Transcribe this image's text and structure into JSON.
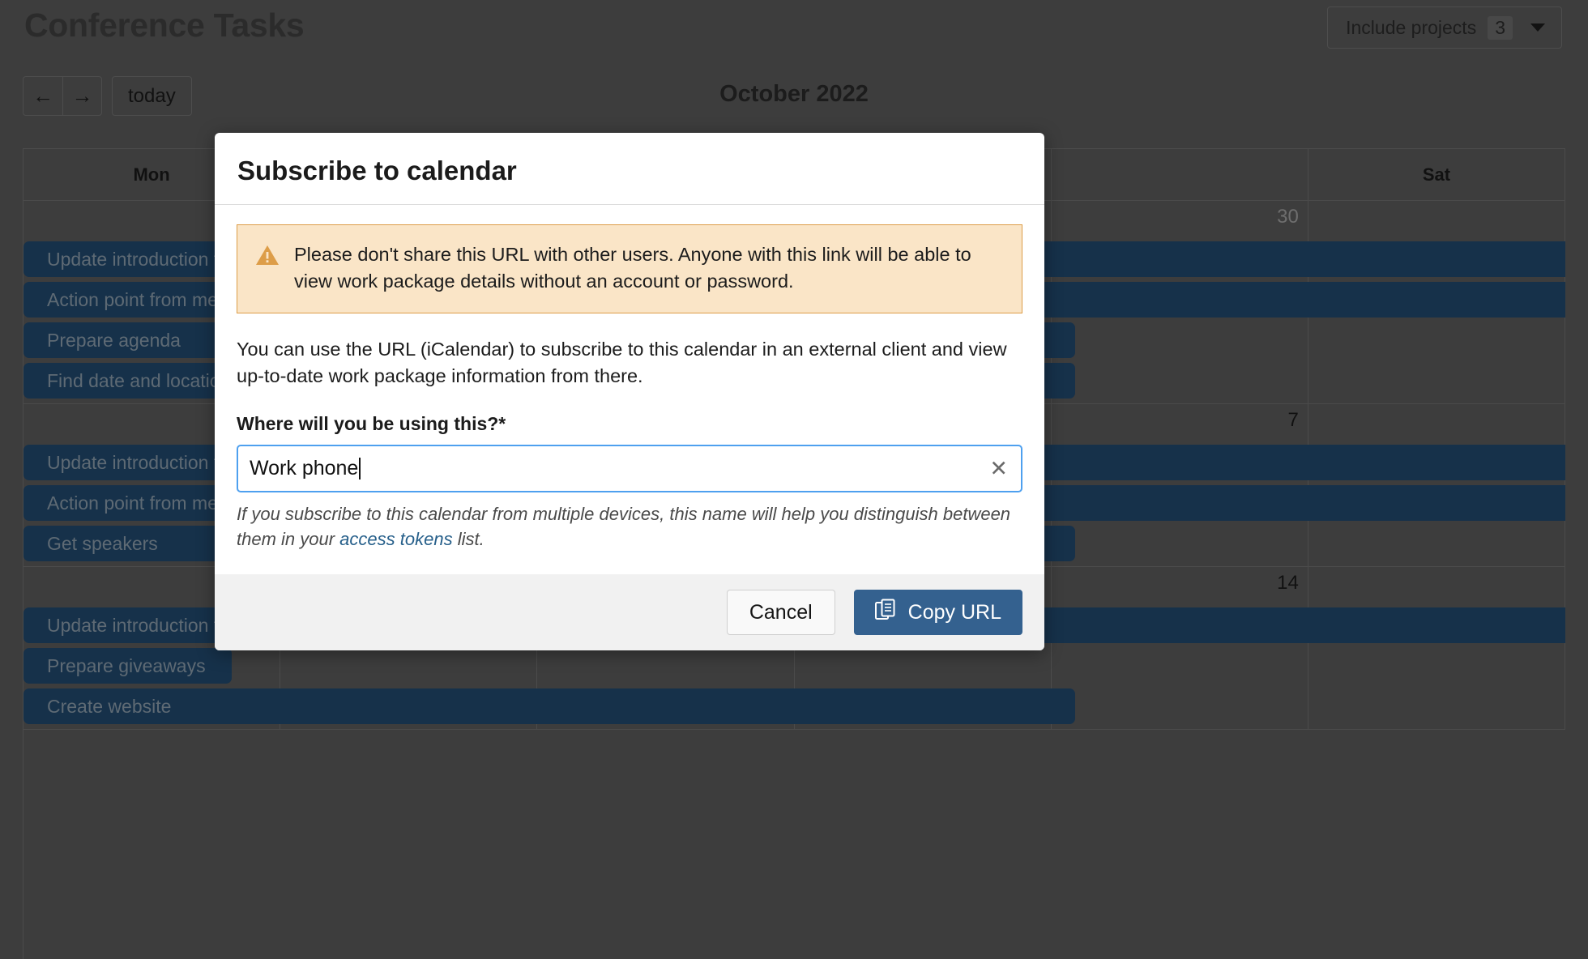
{
  "app": {
    "page_title": "Conference Tasks",
    "include_projects": {
      "label": "Include projects",
      "count": "3",
      "caret_icon": "chevron-down-icon"
    },
    "toolbar": {
      "prev_label": "←",
      "next_label": "→",
      "today_label": "today"
    },
    "calendar": {
      "month_title": "October 2022",
      "day_headers": [
        "Mon",
        "",
        "",
        "",
        "",
        "Sat"
      ],
      "weeks": [
        {
          "daynums": [
            "",
            "",
            "",
            "",
            "30",
            ""
          ],
          "events": [
            {
              "title": "Update introduction text",
              "span": "full"
            },
            {
              "title": "Action point from meeting",
              "span": "full"
            },
            {
              "title": "Prepare agenda",
              "span": "wide"
            },
            {
              "title": "Find date and location",
              "span": "wide"
            }
          ]
        },
        {
          "daynums": [
            "",
            "",
            "",
            "",
            "7",
            ""
          ],
          "events": [
            {
              "title": "Update introduction text",
              "span": "full"
            },
            {
              "title": "Action point from meeting",
              "span": "full"
            },
            {
              "title": "Get speakers",
              "span": "wide"
            }
          ]
        },
        {
          "daynums": [
            "",
            "",
            "",
            "",
            "14",
            ""
          ],
          "events": [
            {
              "title": "Update introduction text",
              "span": "full"
            },
            {
              "title": "Prepare giveaways",
              "span": "narrow"
            },
            {
              "title": "Create website",
              "span": "wide"
            }
          ]
        }
      ]
    }
  },
  "modal": {
    "title": "Subscribe to calendar",
    "warning": {
      "icon": "warning-triangle-icon",
      "text": "Please don't share this URL with other users. Anyone with this link will be able to view work package details without an account or password."
    },
    "body_text": "You can use the URL (iCalendar) to subscribe to this calendar in an external client and view up-to-date work package information from there.",
    "field": {
      "label": "Where will you be using this?*",
      "value": "Work phone",
      "placeholder": "",
      "clear_icon": "close-icon"
    },
    "help": {
      "before_link": "If you subscribe to this calendar from multiple devices, this name will help you distinguish between them in your ",
      "link_text": "access tokens",
      "after_link": " list."
    },
    "footer": {
      "cancel_label": "Cancel",
      "copy_label": "Copy URL",
      "copy_icon": "copy-icon"
    }
  },
  "colors": {
    "app_background": "#3d3d3d",
    "event_block": "#16314a",
    "accent_blue": "#34618f",
    "focus_blue": "#4ea0ef",
    "warning_bg": "#fae5c7",
    "warning_border": "#dd9d48",
    "link": "#265f8a"
  }
}
